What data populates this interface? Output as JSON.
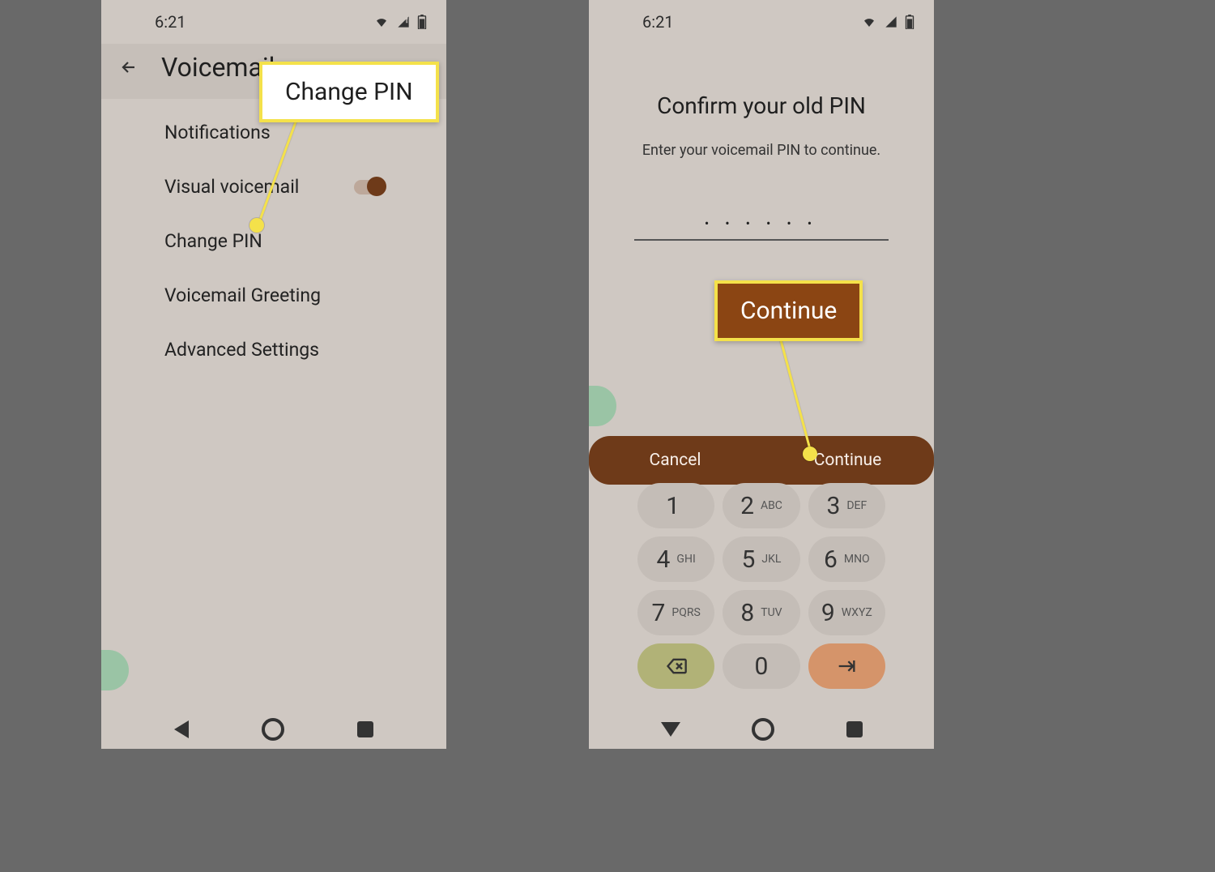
{
  "status": {
    "time": "6:21"
  },
  "left": {
    "header_title": "Voicemail",
    "items": {
      "notifications": "Notifications",
      "visualvm": "Visual voicemail",
      "changepin": "Change PIN",
      "greeting": "Voicemail Greeting",
      "advanced": "Advanced Settings"
    }
  },
  "right": {
    "title": "Confirm your old PIN",
    "subtitle": "Enter your voicemail PIN to continue.",
    "pin_value": "• • • • • •",
    "cancel": "Cancel",
    "continue": "Continue",
    "keys": {
      "k1": {
        "d": "1",
        "l": ""
      },
      "k2": {
        "d": "2",
        "l": "ABC"
      },
      "k3": {
        "d": "3",
        "l": "DEF"
      },
      "k4": {
        "d": "4",
        "l": "GHI"
      },
      "k5": {
        "d": "5",
        "l": "JKL"
      },
      "k6": {
        "d": "6",
        "l": "MNO"
      },
      "k7": {
        "d": "7",
        "l": "PQRS"
      },
      "k8": {
        "d": "8",
        "l": "TUV"
      },
      "k9": {
        "d": "9",
        "l": "WXYZ"
      },
      "k0": {
        "d": "0",
        "l": ""
      }
    }
  },
  "callouts": {
    "changepin": "Change PIN",
    "continue": "Continue"
  }
}
